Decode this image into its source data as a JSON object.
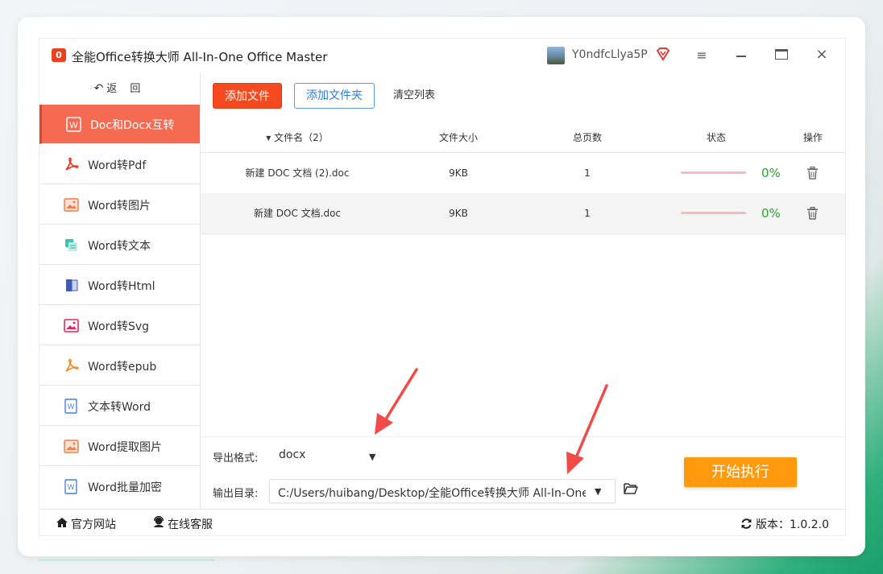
{
  "app": {
    "logo_text": "0",
    "title": "全能Office转换大师 All-In-One Office Master",
    "username": "Y0ndfcLlya5P"
  },
  "sidebar": {
    "back_label": "返 回",
    "items": [
      {
        "label": "Doc和Docx互转",
        "icon": "word-icon",
        "active": true
      },
      {
        "label": "Word转Pdf",
        "icon": "pdf-icon"
      },
      {
        "label": "Word转图片",
        "icon": "image-icon"
      },
      {
        "label": "Word转文本",
        "icon": "text-icon"
      },
      {
        "label": "Word转Html",
        "icon": "html-icon"
      },
      {
        "label": "Word转Svg",
        "icon": "svg-icon"
      },
      {
        "label": "Word转epub",
        "icon": "epub-icon"
      },
      {
        "label": "文本转Word",
        "icon": "word-doc-icon"
      },
      {
        "label": "Word提取图片",
        "icon": "extract-image-icon"
      },
      {
        "label": "Word批量加密",
        "icon": "encrypt-icon"
      }
    ]
  },
  "toolbar": {
    "add_file": "添加文件",
    "add_folder": "添加文件夹",
    "clear_list": "清空列表"
  },
  "table": {
    "headers": {
      "filename": "▾ 文件名（2）",
      "size": "文件大小",
      "pages": "总页数",
      "status": "状态",
      "action": "操作"
    },
    "rows": [
      {
        "filename": "新建 DOC 文档 (2).doc",
        "size": "9KB",
        "pages": "1",
        "progress": "0%"
      },
      {
        "filename": "新建 DOC 文档.doc",
        "size": "9KB",
        "pages": "1",
        "progress": "0%"
      }
    ]
  },
  "options": {
    "format_label": "导出格式:",
    "format_value": "docx",
    "dir_label": "输出目录:",
    "dir_value": "C:/Users/huibang/Desktop/全能Office转换大师 All-In-One"
  },
  "start_button": "开始执行",
  "footer": {
    "website": "官方网站",
    "support": "在线客服",
    "version": "版本：1.0.2.0"
  },
  "colors": {
    "accent": "#f54a1f",
    "start": "#ff9a0f",
    "progress_text": "#27a22a",
    "annotation_arrow": "#f04b48"
  }
}
